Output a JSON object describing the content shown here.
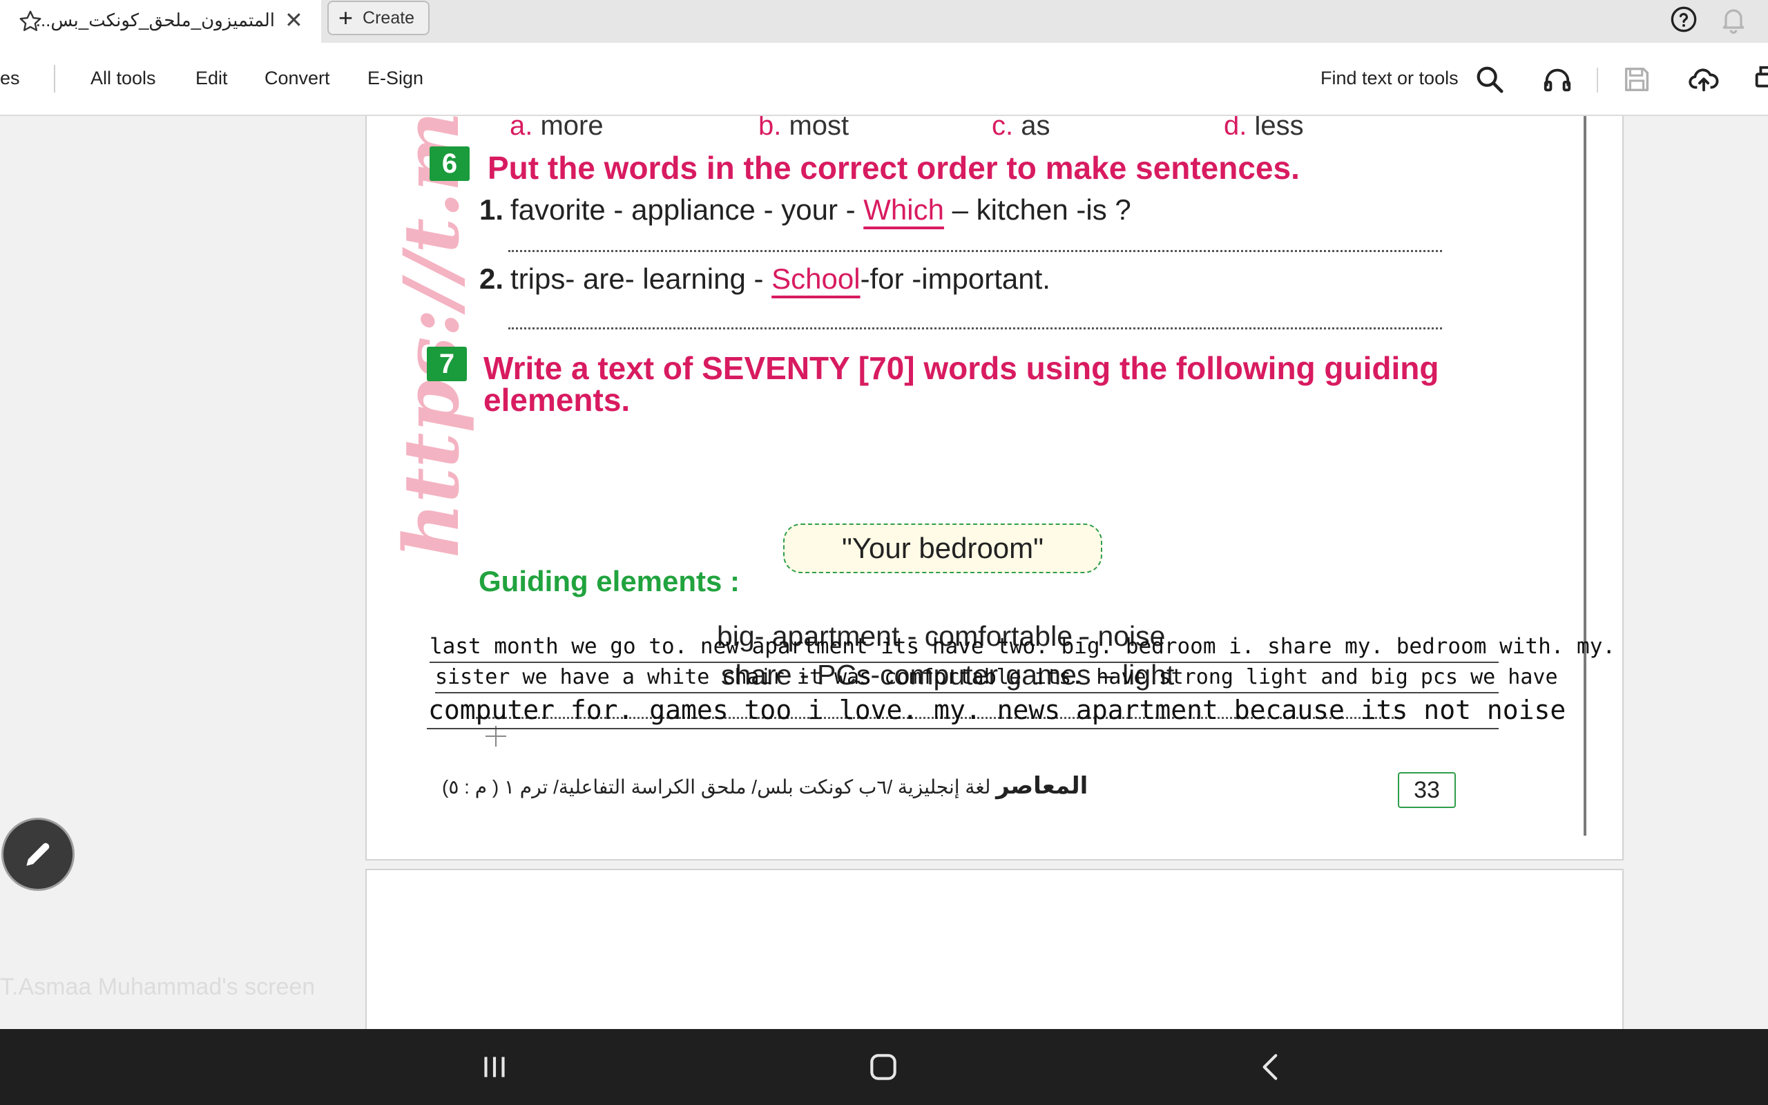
{
  "tab": {
    "title": "المتميزون_ملحق_كونكت_بس...",
    "close_glyph": "✕",
    "create_label": "Create"
  },
  "toolbar": {
    "cut_label": "es",
    "menu": [
      "All tools",
      "Edit",
      "Convert",
      "E-Sign"
    ],
    "find_label": "Find text or tools"
  },
  "document": {
    "prev_choices": [
      {
        "letter": "a.",
        "word": "more"
      },
      {
        "letter": "b.",
        "word": "most"
      },
      {
        "letter": "c.",
        "word": "as"
      },
      {
        "letter": "d.",
        "word": "less"
      }
    ],
    "watermark": "https://t.me/C",
    "q6": {
      "number": "6",
      "heading": "Put the words in the correct order to make sentences.",
      "items": [
        {
          "num": "1.",
          "pre": "favorite - appliance - your - ",
          "underlined": "Which",
          "post": " – kitchen -is ?"
        },
        {
          "num": "2.",
          "pre": "trips- are- learning - ",
          "underlined": "School",
          "post": "-for -important."
        }
      ]
    },
    "q7": {
      "number": "7",
      "heading_line1": "Write a text of SEVENTY [70] words using the following guiding",
      "heading_line2": "elements.",
      "topic": "\"Your bedroom\"",
      "guiding_label": "Guiding elements :",
      "guiding_line1": "big- apartment - comfortable - noise",
      "guiding_line2": "share - PCs-computer games – light"
    },
    "handwriting": [
      "last month we go to. new apartment  its have two. big. bedroom i. share my. bedroom with. my.",
      "sister  we have a white chair it was comfortable its. have strong light and big pcs we have",
      "computer for. games too i love. my. news apartment because its not noise"
    ],
    "footer_brand": "المعاصر",
    "footer_text": "لغة إنجليزية /٦ب كونكت بلس/ ملحق الكراسة التفاعلية/ ترم ١ ( م : ٥)",
    "page_number": "33"
  },
  "screen_share_label": "T.Asmaa Muhammad's screen",
  "colors": {
    "heading_pink": "#d81b60",
    "badge_green": "#1a9b3c",
    "guiding_green": "#21a33e"
  }
}
